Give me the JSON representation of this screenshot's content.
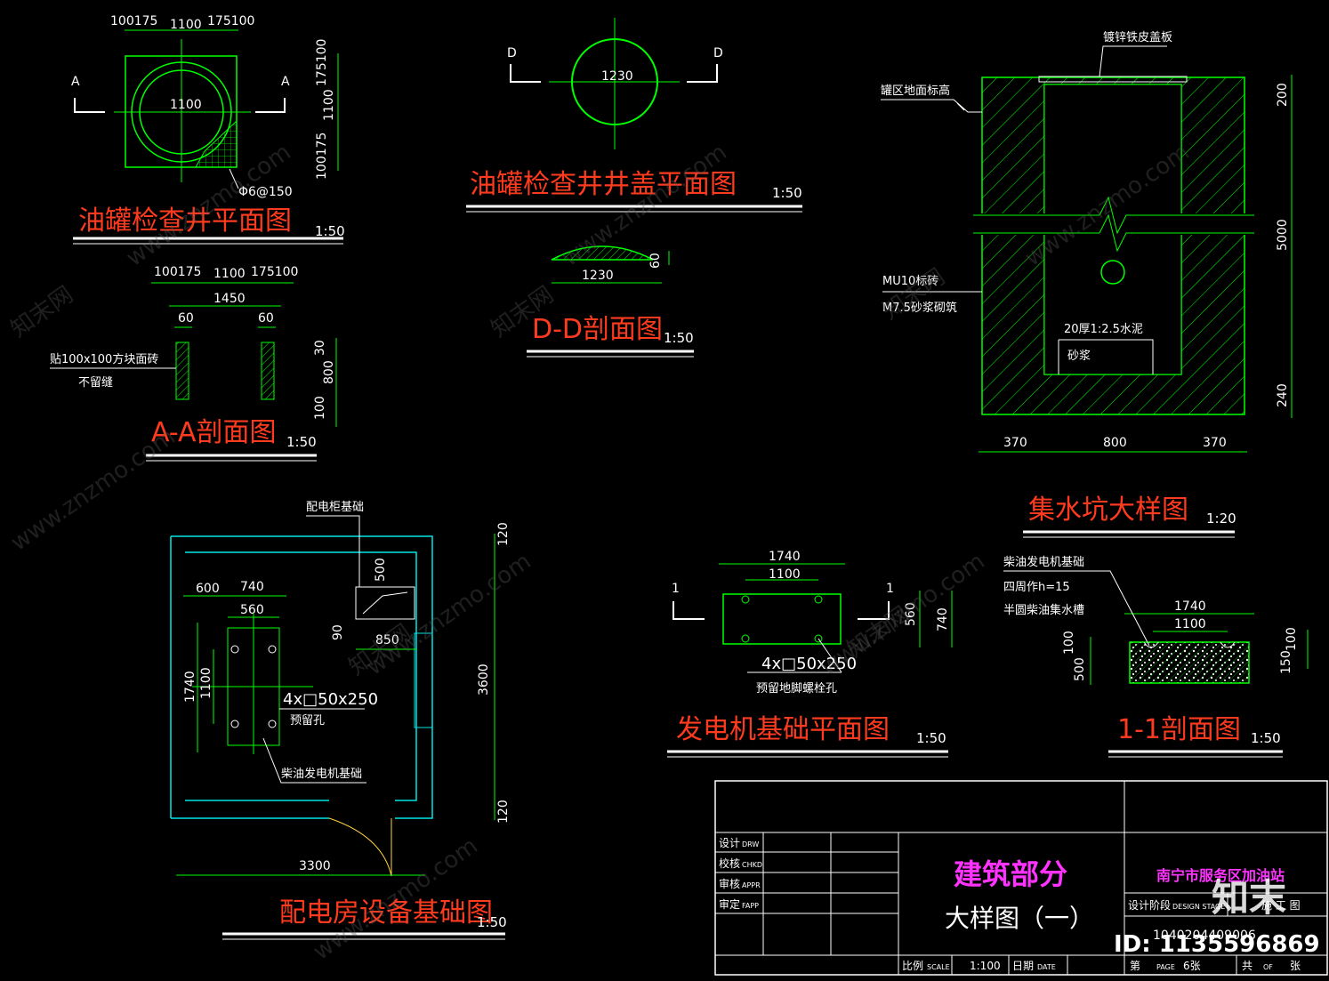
{
  "drawings": {
    "well_plan": {
      "title": "油罐检查井平面图",
      "scale": "1:50",
      "dim_top": [
        "100175",
        "1100",
        "175100"
      ],
      "dim_inner": "1100",
      "dim_right": [
        "175100",
        "1100",
        "100175"
      ],
      "rebar": "Φ6@150",
      "sec_mark": "A"
    },
    "cover_plan": {
      "title": "油罐检查井井盖平面图",
      "scale": "1:50",
      "dia": "1230",
      "sec_mark": "D"
    },
    "dd_section": {
      "title": "D-D剖面图",
      "scale": "1:50",
      "width": "1230",
      "height": "60"
    },
    "aa_section": {
      "title": "A-A剖面图",
      "scale": "1:50",
      "dim_top": [
        "100175",
        "1100",
        "175100"
      ],
      "dim_total": "1450",
      "wall": [
        "60",
        "60"
      ],
      "dim_right": [
        "30",
        "800",
        "100"
      ],
      "note1": "贴100x100方块面砖",
      "note2": "不留缝"
    },
    "sump": {
      "title": "集水坑大样图",
      "scale": "1:20",
      "cover_label": "镀锌铁皮盖板",
      "ground_label": "罐区地面标高",
      "brick1": "MU10标砖",
      "brick2": "M7.5砂浆砌筑",
      "mortar1": "20厚1:2.5水泥",
      "mortar2": "砂浆",
      "dim_right": [
        "200",
        "5000",
        "240"
      ],
      "dim_bottom": [
        "370",
        "800",
        "370"
      ]
    },
    "room": {
      "title": "配电房设备基础图",
      "scale": "1:50",
      "cabinet_label": "配电柜基础",
      "d500": "500",
      "d90": "90",
      "d850": "850",
      "d600": "600",
      "d740": "740",
      "d560": "560",
      "d1740": "1740",
      "d1100": "1100",
      "holes": "4x□50x250",
      "holes_note": "预留孔",
      "gen_label": "柴油发电机基础",
      "d3600": "3600",
      "d120a": "120",
      "d120b": "120",
      "d3300": "3300"
    },
    "gen_plan": {
      "title": "发电机基础平面图",
      "scale": "1:50",
      "d1740": "1740",
      "d1100": "1100",
      "d560": "560",
      "d740": "740",
      "holes": "4x□50x250",
      "holes_note": "预留地脚螺栓孔",
      "sec_mark": "1"
    },
    "sec11": {
      "title": "1-1剖面图",
      "scale": "1:50",
      "n1": "柴油发电机基础",
      "n2": "四周作h=15",
      "n3": "半圆柴油集水槽",
      "d1740": "1740",
      "d1100": "1100",
      "dl": [
        "100",
        "500"
      ],
      "dr": [
        "150",
        "100"
      ]
    }
  },
  "title_block": {
    "rows": [
      [
        "设计",
        "DRW"
      ],
      [
        "校核",
        "CHKD"
      ],
      [
        "审核",
        "APPR"
      ],
      [
        "审定",
        "FAPP"
      ]
    ],
    "project": "建筑部分",
    "drawing_name": "大样图（一）",
    "client": "南宁市服务区加油站",
    "stage_label": "设计阶段",
    "stage_label_en": "DESIGN STAGE",
    "stage": "施 工 图",
    "scale_label": "比例",
    "scale_label_en": "SCALE",
    "scale": "1:100",
    "date_label": "日期",
    "date_label_en": "DATE",
    "number": "1040204409006",
    "page_label": "第",
    "page_en": "PAGE",
    "page": "6张",
    "of_label": "共",
    "of_en": "OF",
    "of": "张"
  },
  "watermark": {
    "site": "www.znzmo.com",
    "brand": "知末网",
    "logo": "知末",
    "id": "ID: 1135596869"
  },
  "colors": {
    "line": "#00ff00",
    "title": "#ff3b1f",
    "dim": "#ffffff",
    "room": "#00e5e5",
    "magenta": "#ff33ff"
  }
}
